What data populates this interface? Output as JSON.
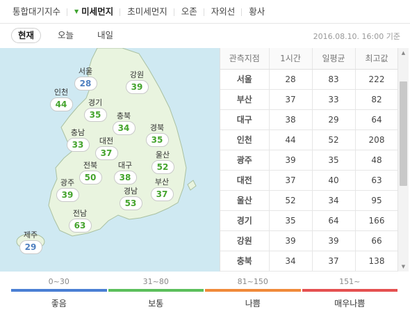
{
  "top_tabs": [
    {
      "label": "통합대기지수",
      "active": false
    },
    {
      "label": "미세먼지",
      "active": true
    },
    {
      "label": "초미세먼지",
      "active": false
    },
    {
      "label": "오존",
      "active": false
    },
    {
      "label": "자외선",
      "active": false
    },
    {
      "label": "황사",
      "active": false
    }
  ],
  "time_tabs": [
    {
      "label": "현재",
      "active": true
    },
    {
      "label": "오늘",
      "active": false
    },
    {
      "label": "내일",
      "active": false
    }
  ],
  "timestamp": "2016.08.10. 16:00 기준",
  "colors": {
    "good": "#4f80c0",
    "normal": "#45a42e",
    "bad": "#f08a2a",
    "very_bad": "#e04a4a",
    "sea": "#cfe9f2",
    "land": "#e9f4df"
  },
  "map_cities": [
    {
      "name": "서울",
      "value": "28",
      "grade": "good"
    },
    {
      "name": "강원",
      "value": "39",
      "grade": "normal"
    },
    {
      "name": "인천",
      "value": "44",
      "grade": "normal"
    },
    {
      "name": "경기",
      "value": "35",
      "grade": "normal"
    },
    {
      "name": "충북",
      "value": "34",
      "grade": "normal"
    },
    {
      "name": "충남",
      "value": "33",
      "grade": "normal"
    },
    {
      "name": "대전",
      "value": "37",
      "grade": "normal"
    },
    {
      "name": "경북",
      "value": "35",
      "grade": "normal"
    },
    {
      "name": "울산",
      "value": "52",
      "grade": "normal"
    },
    {
      "name": "전북",
      "value": "50",
      "grade": "normal"
    },
    {
      "name": "대구",
      "value": "38",
      "grade": "normal"
    },
    {
      "name": "부산",
      "value": "37",
      "grade": "normal"
    },
    {
      "name": "광주",
      "value": "39",
      "grade": "normal"
    },
    {
      "name": "경남",
      "value": "53",
      "grade": "normal"
    },
    {
      "name": "전남",
      "value": "63",
      "grade": "normal"
    },
    {
      "name": "제주",
      "value": "29",
      "grade": "good"
    }
  ],
  "table": {
    "headers": [
      "관측지점",
      "1시간",
      "일평균",
      "최고값"
    ],
    "rows": [
      [
        "서울",
        "28",
        "83",
        "222"
      ],
      [
        "부산",
        "37",
        "33",
        "82"
      ],
      [
        "대구",
        "38",
        "29",
        "64"
      ],
      [
        "인천",
        "44",
        "52",
        "208"
      ],
      [
        "광주",
        "39",
        "35",
        "48"
      ],
      [
        "대전",
        "37",
        "40",
        "63"
      ],
      [
        "울산",
        "52",
        "34",
        "95"
      ],
      [
        "경기",
        "35",
        "64",
        "166"
      ],
      [
        "강원",
        "39",
        "39",
        "66"
      ],
      [
        "충북",
        "34",
        "37",
        "138"
      ]
    ]
  },
  "legend": [
    {
      "range": "0~30",
      "label": "좋음",
      "color": "#4a7fd4"
    },
    {
      "range": "31~80",
      "label": "보통",
      "color": "#5cbf5c"
    },
    {
      "range": "81~150",
      "label": "나쁨",
      "color": "#f08a3a"
    },
    {
      "range": "151~",
      "label": "매우나쁨",
      "color": "#e55050"
    }
  ],
  "icons": {
    "caret": "caret-down-icon",
    "scroll_up": "scroll-up-icon",
    "scroll_down": "scroll-down-icon"
  }
}
